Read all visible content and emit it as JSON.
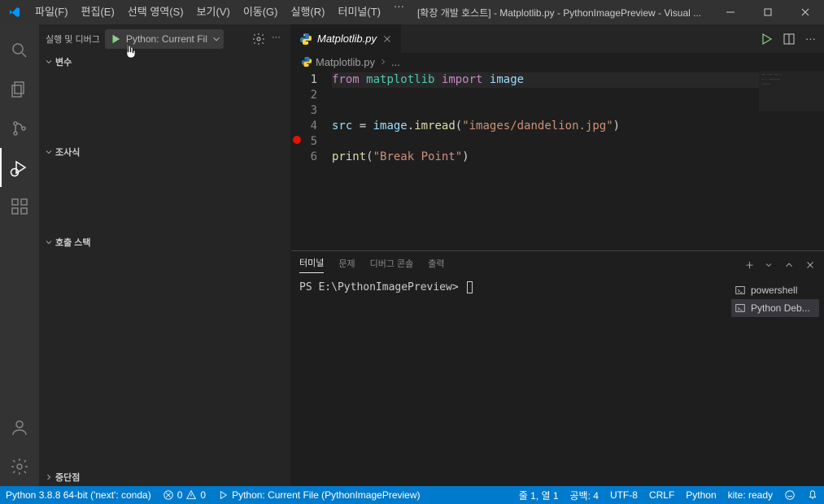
{
  "titlebar": {
    "title": "[확장 개발 호스트] - Matplotlib.py - PythonImagePreview - Visual ..."
  },
  "menubar": [
    "파일(F)",
    "편집(E)",
    "선택 영역(S)",
    "보기(V)",
    "이동(G)",
    "실행(R)",
    "터미널(T)"
  ],
  "sidebar": {
    "header": "실행 및 디버그",
    "config": "Python: Current Fil",
    "sections": {
      "variables": "변수",
      "watch": "조사식",
      "callstack": "호출 스택",
      "breakpoints": "중단점"
    }
  },
  "tab": {
    "name": "Matplotlib.py"
  },
  "breadcrumb": {
    "filename": "Matplotlib.py",
    "more": "..."
  },
  "code": {
    "l1a": "from",
    "l1b": "matplotlib",
    "l1c": "import",
    "l1d": "image",
    "l3a": "src",
    "l3b": " = ",
    "l3c": "image",
    "l3d": ".",
    "l3e": "imread",
    "l3f": "(",
    "l3g": "\"images/dandelion.jpg\"",
    "l3h": ")",
    "l5a": "print",
    "l5b": "(",
    "l5c": "\"Break Point\"",
    "l5d": ")"
  },
  "panel": {
    "tabs": [
      "터미널",
      "문제",
      "디버그 콘솔",
      "출력"
    ],
    "prompt": "PS E:\\PythonImagePreview> ",
    "terminals": [
      "powershell",
      "Python Deb..."
    ]
  },
  "status": {
    "python": "Python 3.8.8 64-bit ('next': conda)",
    "errors": "0",
    "warnings": "0",
    "debug": "Python: Current File (PythonImagePreview)",
    "lncol": "줄 1, 열 1",
    "spaces": "공백: 4",
    "encoding": "UTF-8",
    "eol": "CRLF",
    "lang": "Python",
    "kite": "kite: ready"
  }
}
